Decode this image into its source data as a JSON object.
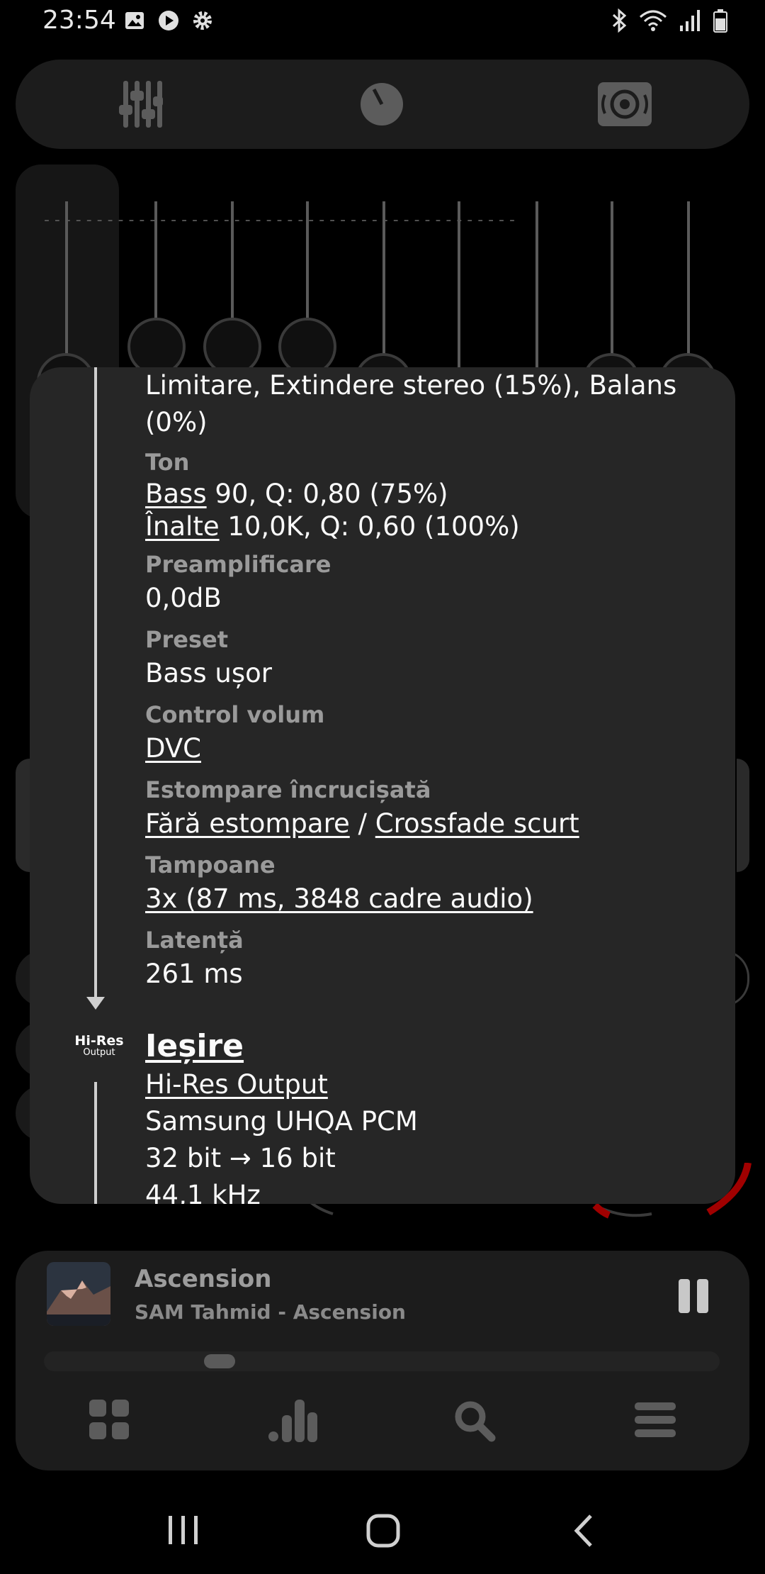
{
  "status_bar": {
    "time": "23:54",
    "left_icons": [
      "image-icon",
      "play-icon",
      "settings-icon"
    ],
    "right_icons": [
      "bluetooth-icon",
      "wifi-icon",
      "signal-icon",
      "battery-icon"
    ]
  },
  "top_tabs": {
    "items": [
      {
        "name": "equalizer-icon"
      },
      {
        "name": "knob-icon"
      },
      {
        "name": "speaker-icon"
      }
    ]
  },
  "overlay": {
    "effects_line1": "Limitare, Extindere stereo (15%), Balans",
    "effects_line2": "(0%)",
    "tone_label": "Ton",
    "bass_link": "Bass",
    "bass_value": " 90, Q: 0,80 (75%)",
    "treble_link": "Înalte",
    "treble_value": " 10,0K, Q: 0,60 (100%)",
    "preamp_label": "Preamplificare",
    "preamp_value": "0,0dB",
    "preset_label": "Preset",
    "preset_value": "Bass ușor",
    "volume_label": "Control volum",
    "volume_value": "DVC",
    "crossfade_label": "Estompare încrucișată",
    "crossfade_value1": "Fără estompare",
    "crossfade_sep": " / ",
    "crossfade_value2": "Crossfade scurt",
    "buffers_label": "Tampoane",
    "buffers_value": "3x (87 ms, 3848 cadre audio)",
    "latency_label": "Latență",
    "latency_value": "261 ms",
    "hires_badge_line1": "Hi-Res",
    "hires_badge_line2": "Output",
    "output_title": "Ieșire",
    "output_device": "Hi-Res Output",
    "output_driver": "Samsung UHQA PCM",
    "output_bits": "32 bit → 16 bit",
    "output_rate": "44,1 kHz"
  },
  "now_playing": {
    "title": "Ascension",
    "subtitle": "SAM Tahmid - Ascension",
    "progress": 0.25
  },
  "bottom_nav": {
    "items": [
      "grid-icon",
      "bars-icon",
      "search-icon",
      "menu-icon"
    ]
  },
  "system_nav": [
    "recents-icon",
    "home-icon",
    "back-icon"
  ],
  "colors": {
    "background": "#000000",
    "card": "#262626",
    "panel": "#1c1c1c",
    "label_gray": "#9a9a9a",
    "accent_red": "#b00000",
    "accent_yellow": "#c8b400"
  }
}
